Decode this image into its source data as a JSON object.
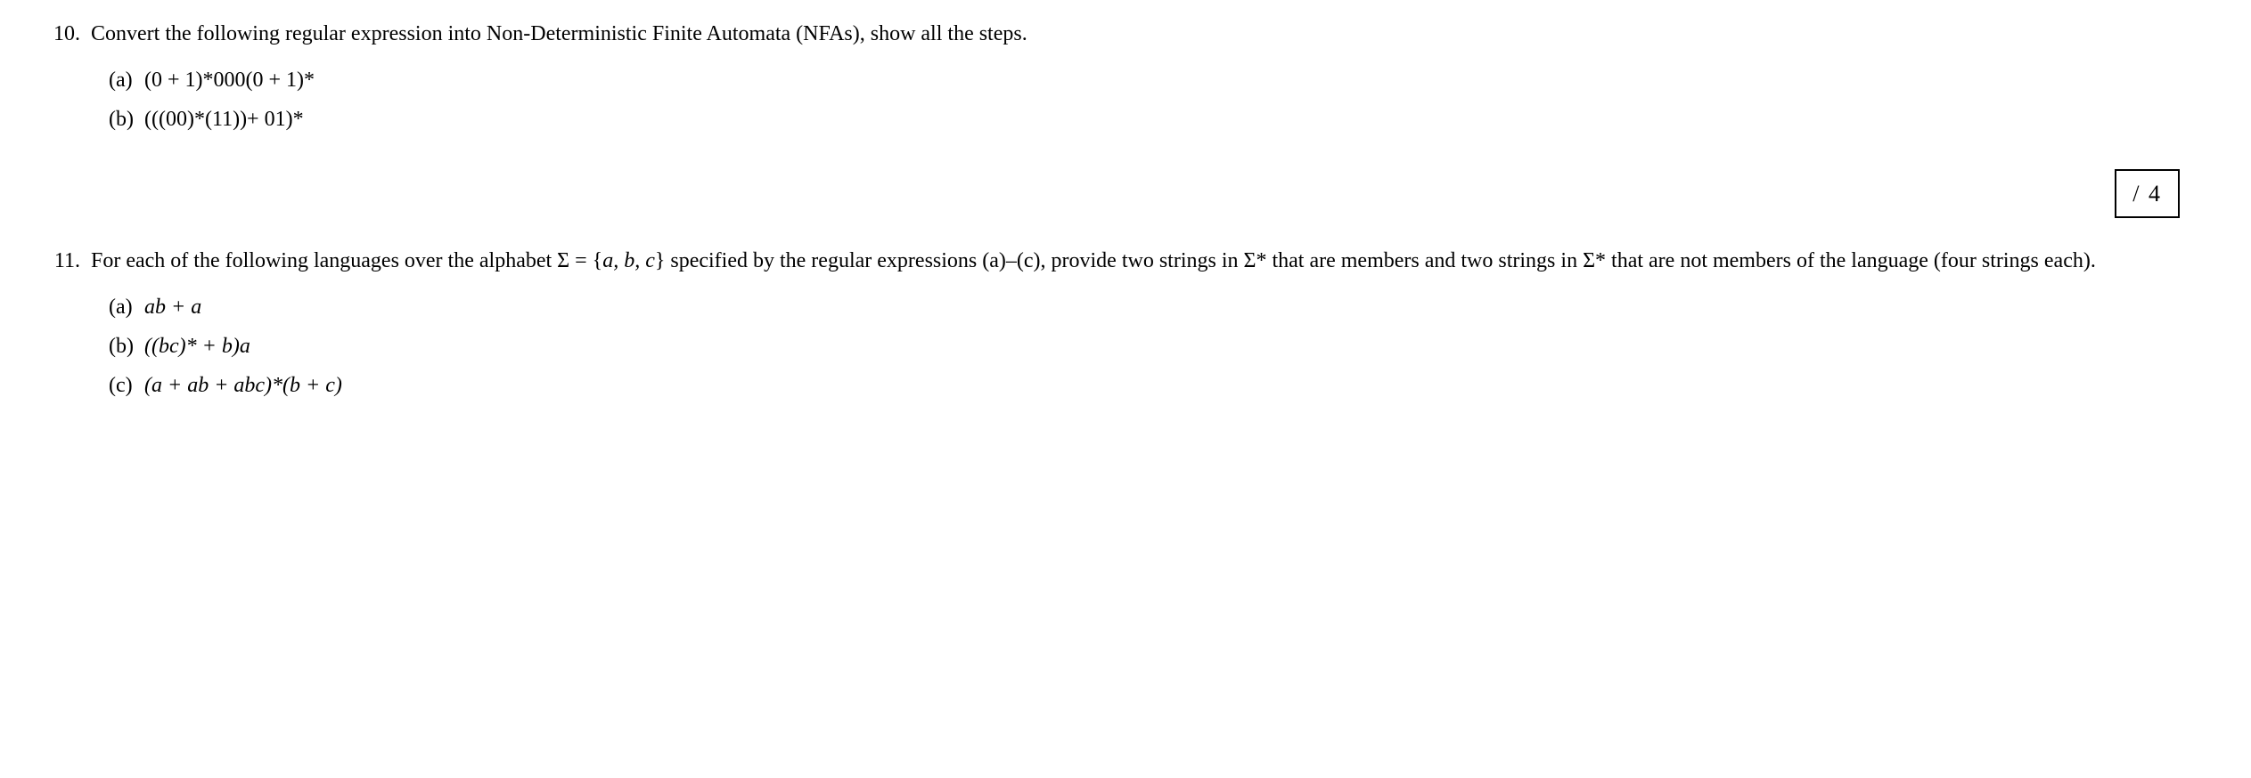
{
  "q10": {
    "number": "10.",
    "text": "Convert the following regular expression into Non-Deterministic Finite Automata (NFAs), show all the steps.",
    "parts": {
      "a": {
        "label": "(a)",
        "expr": "(0 + 1)*000(0 + 1)*"
      },
      "b": {
        "label": "(b)",
        "expr": "(((00)*(11))+ 01)*"
      }
    }
  },
  "score": {
    "text": "/ 4"
  },
  "q11": {
    "number": "11.",
    "text_pre": "For each of the following languages over the alphabet Σ = {",
    "alphabet": "a, b, c",
    "text_mid": "} specified by the regular expressions (a)–(c), provide two strings in Σ* that are members and two strings in Σ* that are not members of the language (four strings each).",
    "parts": {
      "a": {
        "label": "(a)",
        "expr": "ab + a"
      },
      "b": {
        "label": "(b)",
        "expr": "((bc)* + b)a"
      },
      "c": {
        "label": "(c)",
        "expr": "(a + ab + abc)*(b + c)"
      }
    }
  }
}
